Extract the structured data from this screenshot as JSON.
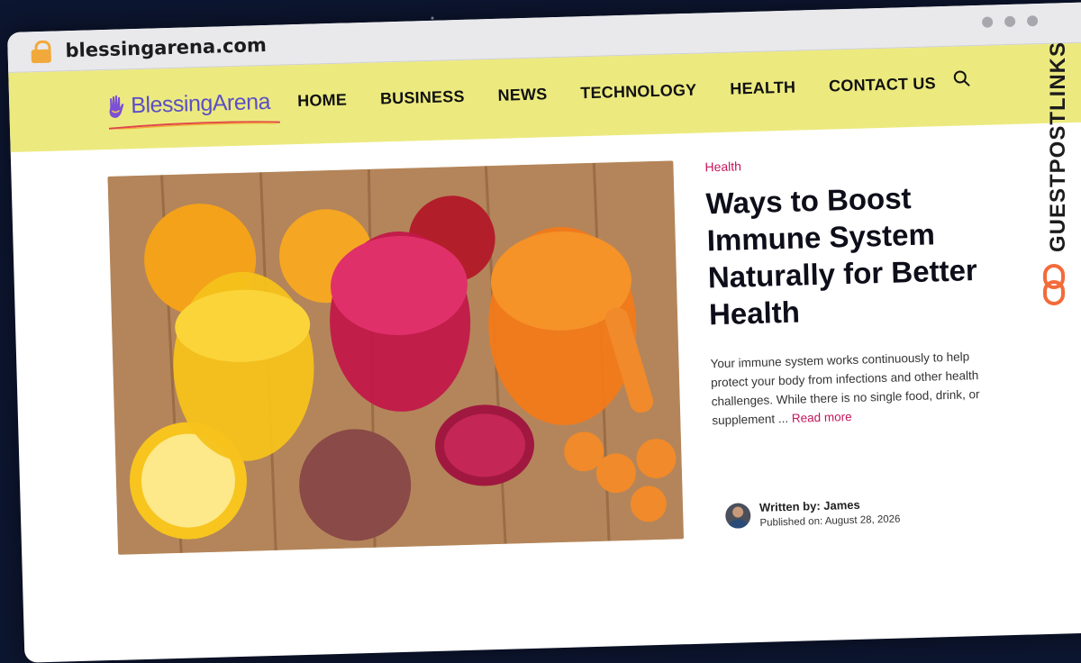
{
  "browser": {
    "url": "blessingarena.com"
  },
  "site": {
    "logo_text": "BlessingArena",
    "nav": [
      "HOME",
      "BUSINESS",
      "NEWS",
      "TECHNOLOGY",
      "HEALTH",
      "CONTACT US"
    ]
  },
  "article": {
    "category": "Health",
    "title": "Ways to Boost Immune System Naturally for Better Health",
    "excerpt": "Your immune system works continuously to help protect your body from infections and other health challenges. While there is no single food, drink, or supplement ...",
    "read_more": "Read more",
    "written_by": "Written by: James",
    "published_on": "Published on: August 28, 2026"
  },
  "watermark": {
    "text": "GUESTPOSTLINKS"
  },
  "colors": {
    "nav_bg": "#ecea7f",
    "accent": "#c4145b",
    "logo": "#5b4fc4",
    "watermark": "#1c1c1c",
    "watermark_icon": "#f26b3a"
  },
  "icons": [
    "lock-icon",
    "search-icon",
    "hand-logo-icon",
    "link-icon"
  ]
}
